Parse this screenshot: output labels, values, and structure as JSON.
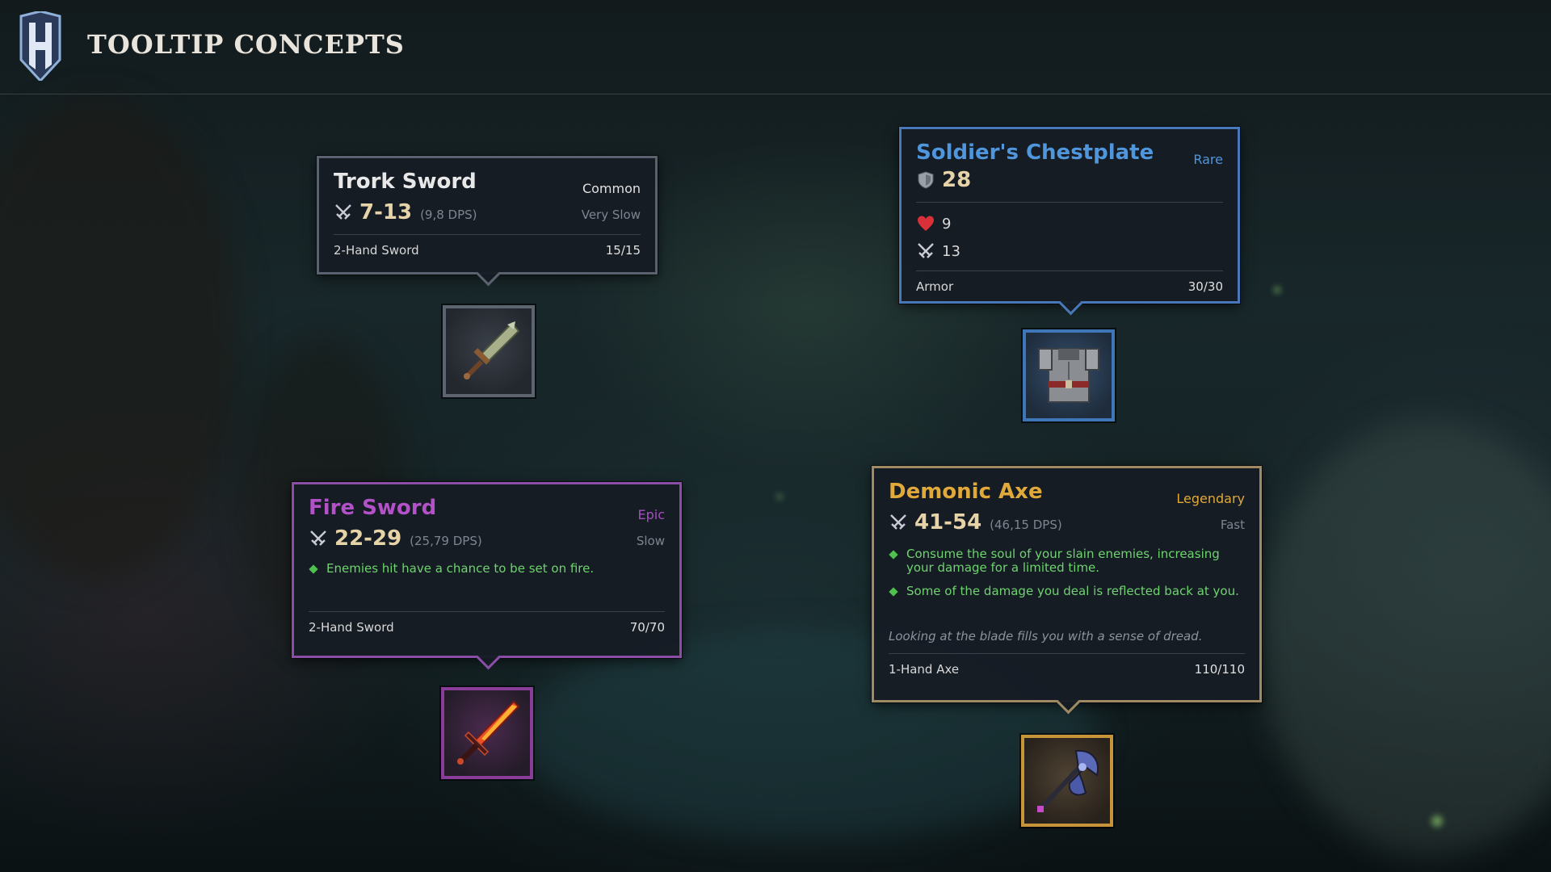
{
  "header": {
    "title": "TOOLTIP CONCEPTS",
    "logo_icon": "h-shield-logo"
  },
  "tooltips": {
    "trork": {
      "name": "Trork Sword",
      "rarity": "Common",
      "damage": "7-13",
      "dps": "(9,8 DPS)",
      "speed": "Very Slow",
      "type": "2-Hand Sword",
      "durability": "15/15",
      "color": "#e8e8e8"
    },
    "chestplate": {
      "name": "Soldier's Chestplate",
      "rarity": "Rare",
      "armor": "28",
      "health": "9",
      "attack": "13",
      "type": "Armor",
      "durability": "30/30",
      "color": "#4f96dc"
    },
    "fire": {
      "name": "Fire Sword",
      "rarity": "Epic",
      "damage": "22-29",
      "dps": "(25,79 DPS)",
      "speed": "Slow",
      "effects": [
        "Enemies hit have a chance to be set on fire."
      ],
      "type": "2-Hand Sword",
      "durability": "70/70",
      "color": "#b351c9"
    },
    "axe": {
      "name": "Demonic Axe",
      "rarity": "Legendary",
      "damage": "41-54",
      "dps": "(46,15 DPS)",
      "speed": "Fast",
      "effects": [
        "Consume the soul of your slain enemies, increasing your damage for a limited time.",
        "Some of the damage you deal is reflected back at you."
      ],
      "lore": "Looking at the blade fills you with a sense of dread.",
      "type": "1-Hand Axe",
      "durability": "110/110",
      "color": "#e1a93a"
    }
  },
  "icons": {
    "damage": "crossed-swords-icon",
    "armor": "shield-icon",
    "health": "heart-icon",
    "items": [
      "trork-sword-icon",
      "chestplate-icon",
      "fire-sword-icon",
      "demonic-axe-icon"
    ]
  }
}
